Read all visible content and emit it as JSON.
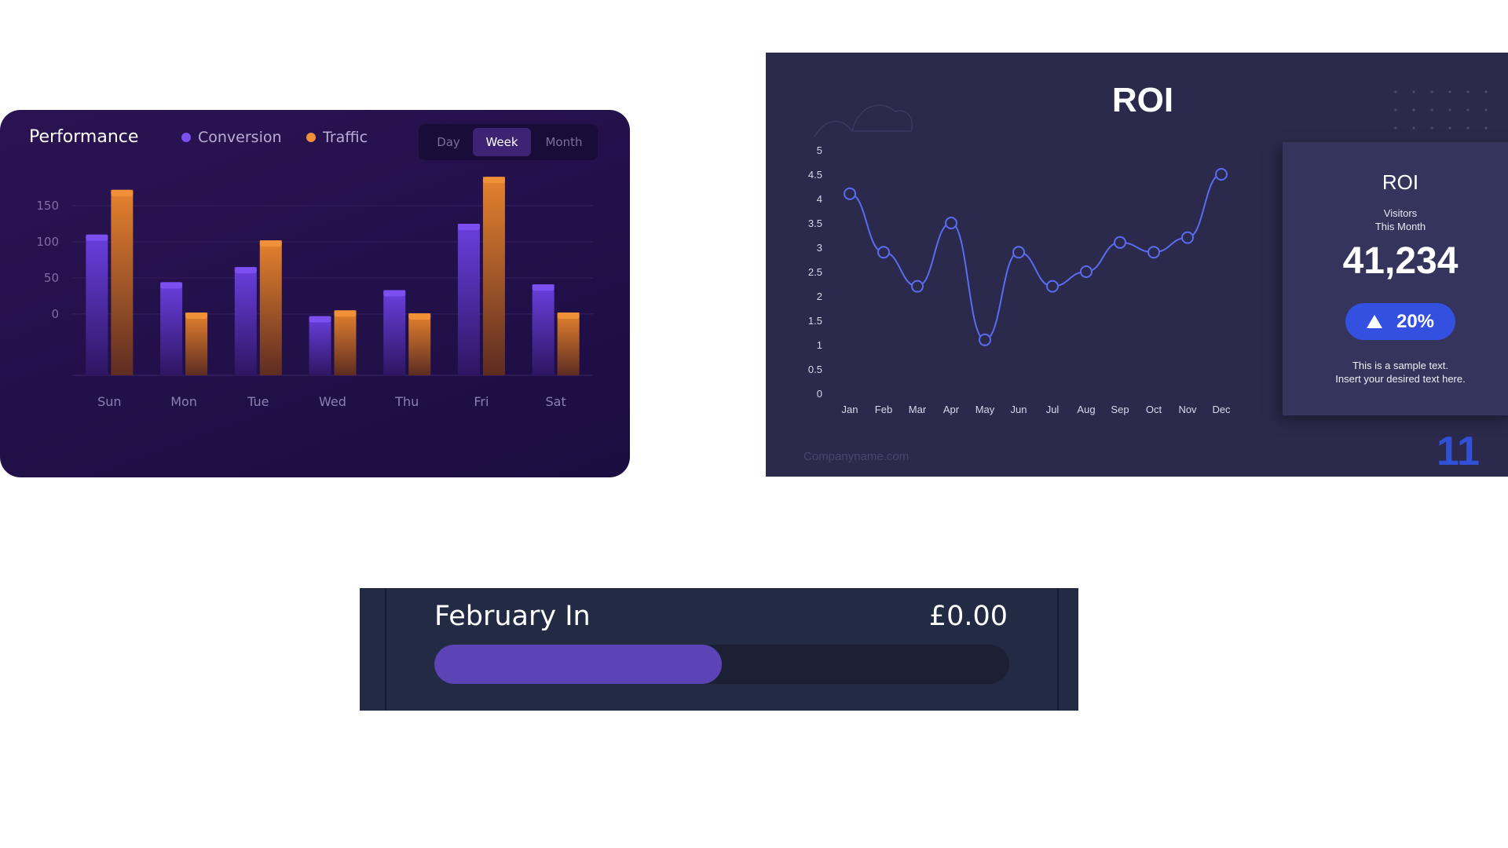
{
  "performance": {
    "title": "Performance",
    "legend": [
      {
        "label": "Conversion",
        "color": "#7b4ff0"
      },
      {
        "label": "Traffic",
        "color": "#f0913a"
      }
    ],
    "range_options": [
      {
        "label": "Day",
        "active": false
      },
      {
        "label": "Week",
        "active": true
      },
      {
        "label": "Month",
        "active": false
      }
    ]
  },
  "roi": {
    "title": "ROI",
    "card": {
      "title": "ROI",
      "subtitle_line1": "Visitors",
      "subtitle_line2": "This Month",
      "value": "41,234",
      "badge": "20%",
      "note_line1": "This is a sample text.",
      "note_line2": "Insert your desired text here."
    },
    "footer": "Companyname.com",
    "slide_number": "11"
  },
  "february": {
    "label": "February In",
    "amount": "£0.00",
    "progress": 0.5
  },
  "chart_data": [
    {
      "type": "bar",
      "title": "Performance",
      "categories": [
        "Sun",
        "Mon",
        "Tue",
        "Wed",
        "Thu",
        "Fri",
        "Sat"
      ],
      "series": [
        {
          "name": "Conversion",
          "values": [
            110,
            44,
            65,
            -3,
            33,
            125,
            41
          ],
          "color": "#7b4ff0"
        },
        {
          "name": "Traffic",
          "values": [
            172,
            2,
            102,
            5,
            1,
            190,
            2
          ],
          "color": "#f0913a"
        }
      ],
      "yticks": [
        0,
        50,
        100,
        150
      ],
      "ylim": [
        -85,
        150
      ],
      "grid": true
    },
    {
      "type": "line",
      "title": "ROI",
      "x": [
        "Jan",
        "Feb",
        "Mar",
        "Apr",
        "May",
        "Jun",
        "Jul",
        "Aug",
        "Sep",
        "Oct",
        "Nov",
        "Dec"
      ],
      "series": [
        {
          "values": [
            4.1,
            2.9,
            2.2,
            3.5,
            1.1,
            2.9,
            2.2,
            2.5,
            3.1,
            2.9,
            3.2,
            4.5
          ],
          "color": "#5a6cf0"
        }
      ],
      "yticks": [
        0,
        0.5,
        1,
        1.5,
        2,
        2.5,
        3,
        3.5,
        4,
        4.5,
        5
      ],
      "ylim": [
        0,
        5
      ],
      "grid": false
    }
  ]
}
